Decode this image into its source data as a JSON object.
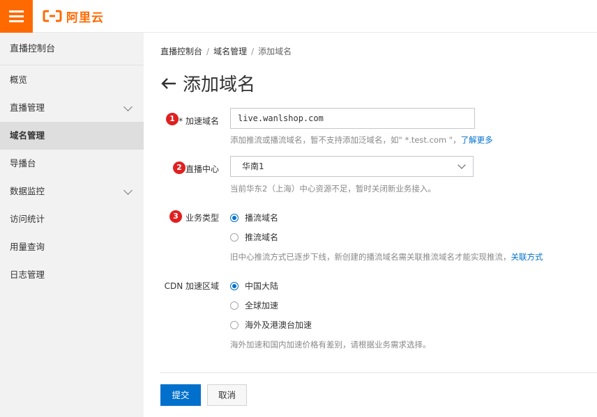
{
  "header": {
    "logo_text": "阿里云",
    "brand_color": "#ff6a00"
  },
  "sidebar": {
    "title": "直播控制台",
    "items": [
      {
        "label": "概览",
        "expandable": false
      },
      {
        "label": "直播管理",
        "expandable": true
      },
      {
        "label": "域名管理",
        "expandable": false,
        "active": true
      },
      {
        "label": "导播台",
        "expandable": false
      },
      {
        "label": "数据监控",
        "expandable": true
      },
      {
        "label": "访问统计",
        "expandable": false
      },
      {
        "label": "用量查询",
        "expandable": false
      },
      {
        "label": "日志管理",
        "expandable": false
      }
    ]
  },
  "breadcrumb": [
    "直播控制台",
    "域名管理",
    "添加域名"
  ],
  "breadcrumb_sep": "/",
  "page": {
    "title": "添加域名"
  },
  "form": {
    "domain": {
      "badge": "1",
      "label": "* 加速域名",
      "value": "live.wanlshop.com",
      "help": "添加推流或播流域名，暂不支持添加泛域名，如\" *.test.com \"，",
      "help_link": "了解更多"
    },
    "center": {
      "badge": "2",
      "label": "直播中心",
      "selected": "华南1",
      "help": "当前华东2（上海）中心资源不足，暂时关闭新业务接入。"
    },
    "business_type": {
      "badge": "3",
      "label": "业务类型",
      "options": [
        {
          "label": "播流域名",
          "checked": true
        },
        {
          "label": "推流域名",
          "checked": false
        }
      ],
      "help": "旧中心推流方式已逐步下线，新创建的播流域名需关联推流域名才能实现推流，",
      "help_link": "关联方式"
    },
    "cdn_region": {
      "label": "CDN 加速区域",
      "options": [
        {
          "label": "中国大陆",
          "checked": true
        },
        {
          "label": "全球加速",
          "checked": false
        },
        {
          "label": "海外及港澳台加速",
          "checked": false
        }
      ],
      "help": "海外加速和国内加速价格有差别，请根据业务需求选择。"
    }
  },
  "actions": {
    "submit": "提交",
    "cancel": "取消"
  },
  "colors": {
    "primary": "#0070cc",
    "badge": "#e02020",
    "link": "#0070cc"
  }
}
